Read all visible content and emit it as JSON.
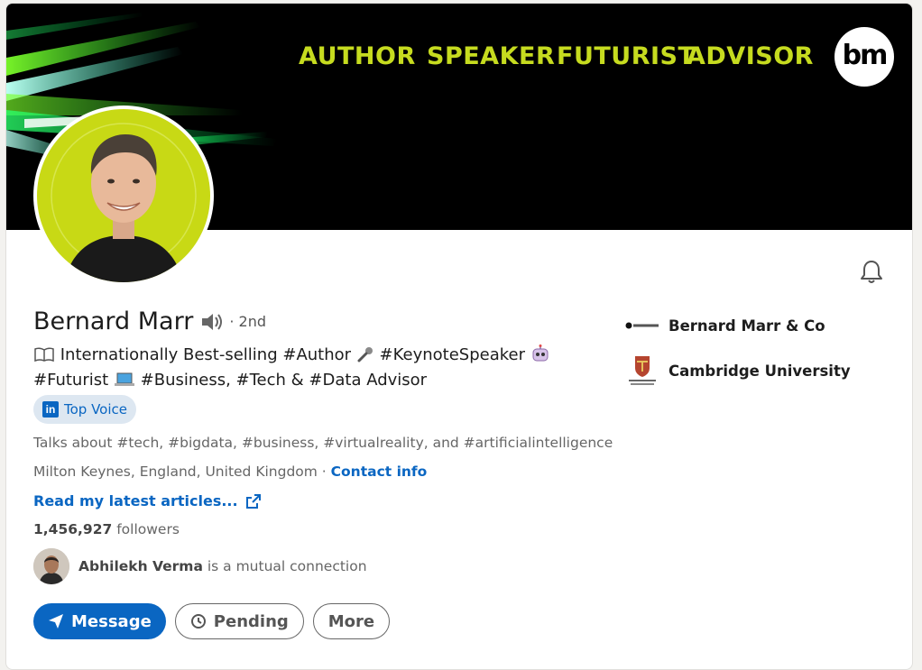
{
  "banner": {
    "taglines": [
      "AUTHOR",
      "SPEAKER",
      "FUTURIST",
      "ADVISOR"
    ],
    "logo_text": "bm",
    "accent_color": "#c6db1f"
  },
  "profile": {
    "name": "Bernard Marr",
    "degree": "· 2nd",
    "headline_line1_a": "Internationally Best-selling #Author",
    "headline_line1_b": "#KeynoteSpeaker",
    "headline_line2_a": "#Futurist",
    "headline_line2_b": "#Business, #Tech & #Data Advisor",
    "badge_label": "Top Voice",
    "badge_icon_text": "in",
    "talks_about": "Talks about #tech, #bigdata, #business, #virtualreality, and #artificialintelligence",
    "location": "Milton Keynes, England, United Kingdom",
    "separator": " · ",
    "contact_info": "Contact info",
    "articles_link": "Read my latest articles...",
    "followers_count": "1,456,927",
    "followers_label": " followers",
    "mutual_name": "Abhilekh Verma",
    "mutual_text": " is a mutual connection"
  },
  "actions": {
    "message": "Message",
    "pending": "Pending",
    "more": "More"
  },
  "side": {
    "company": "Bernard Marr & Co",
    "school": "Cambridge University"
  },
  "colors": {
    "link_blue": "#0a66c2",
    "banner_bg": "#000000",
    "avatar_ring": "#c8d915"
  }
}
